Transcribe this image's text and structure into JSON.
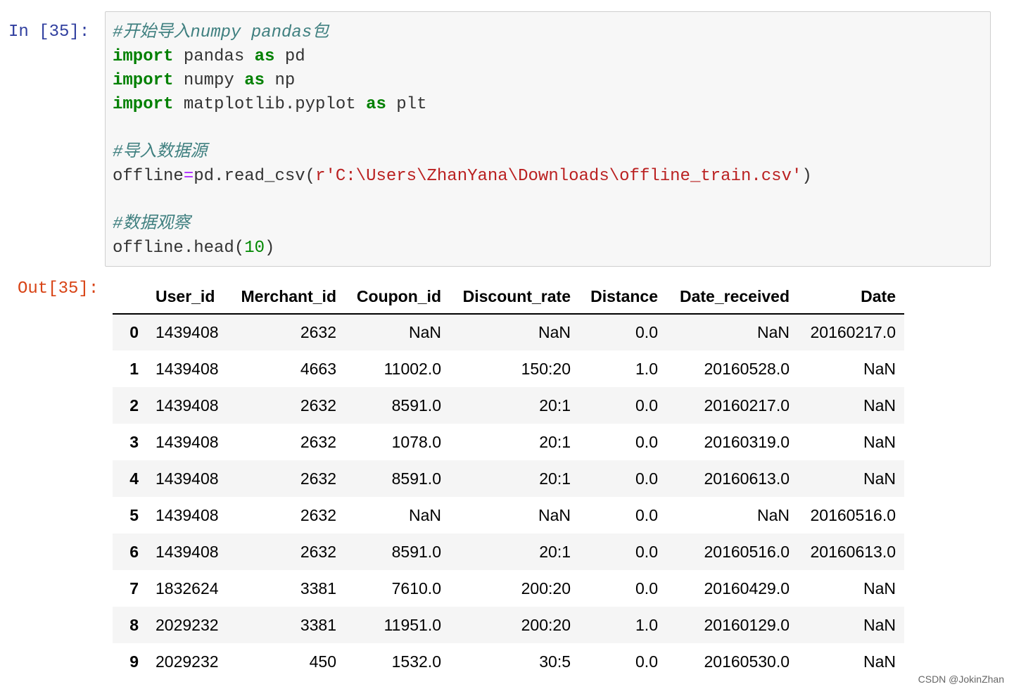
{
  "cell": {
    "in_prompt": "In  [35]:",
    "out_prompt": "Out[35]:",
    "code": {
      "comment1": "#开始导入numpy pandas包",
      "kw_import": "import",
      "kw_as": "as",
      "mod_pandas": " pandas ",
      "alias_pd": " pd",
      "mod_numpy": " numpy ",
      "alias_np": " np",
      "mod_plt": " matplotlib.pyplot ",
      "alias_plt": " plt",
      "comment2": "#导入数据源",
      "assign_lhs": "offline",
      "assign_op": "=",
      "call_read": "pd.read_csv(",
      "path_string": "r'C:\\Users\\ZhanYana\\Downloads\\offline_train.csv'",
      "close_paren": ")",
      "comment3": "#数据观察",
      "call_head": "offline.head(",
      "head_arg": "10",
      "close_paren2": ")"
    }
  },
  "dataframe": {
    "columns": [
      "User_id",
      "Merchant_id",
      "Coupon_id",
      "Discount_rate",
      "Distance",
      "Date_received",
      "Date"
    ],
    "rows": [
      {
        "index": "0",
        "cells": [
          "1439408",
          "2632",
          "NaN",
          "NaN",
          "0.0",
          "NaN",
          "20160217.0"
        ]
      },
      {
        "index": "1",
        "cells": [
          "1439408",
          "4663",
          "11002.0",
          "150:20",
          "1.0",
          "20160528.0",
          "NaN"
        ]
      },
      {
        "index": "2",
        "cells": [
          "1439408",
          "2632",
          "8591.0",
          "20:1",
          "0.0",
          "20160217.0",
          "NaN"
        ]
      },
      {
        "index": "3",
        "cells": [
          "1439408",
          "2632",
          "1078.0",
          "20:1",
          "0.0",
          "20160319.0",
          "NaN"
        ]
      },
      {
        "index": "4",
        "cells": [
          "1439408",
          "2632",
          "8591.0",
          "20:1",
          "0.0",
          "20160613.0",
          "NaN"
        ]
      },
      {
        "index": "5",
        "cells": [
          "1439408",
          "2632",
          "NaN",
          "NaN",
          "0.0",
          "NaN",
          "20160516.0"
        ]
      },
      {
        "index": "6",
        "cells": [
          "1439408",
          "2632",
          "8591.0",
          "20:1",
          "0.0",
          "20160516.0",
          "20160613.0"
        ]
      },
      {
        "index": "7",
        "cells": [
          "1832624",
          "3381",
          "7610.0",
          "200:20",
          "0.0",
          "20160429.0",
          "NaN"
        ]
      },
      {
        "index": "8",
        "cells": [
          "2029232",
          "3381",
          "11951.0",
          "200:20",
          "1.0",
          "20160129.0",
          "NaN"
        ]
      },
      {
        "index": "9",
        "cells": [
          "2029232",
          "450",
          "1532.0",
          "30:5",
          "0.0",
          "20160530.0",
          "NaN"
        ]
      }
    ]
  },
  "watermark": "CSDN @JokinZhan"
}
